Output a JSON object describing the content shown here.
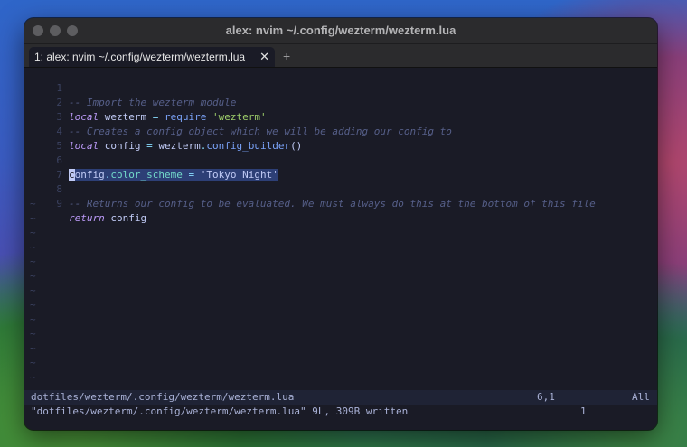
{
  "window": {
    "title": "alex: nvim ~/.config/wezterm/wezterm.lua"
  },
  "tabs": [
    {
      "label": "1: alex: nvim ~/.config/wezterm/wezterm.lua",
      "close_glyph": "✕"
    }
  ],
  "new_tab_glyph": "+",
  "editor": {
    "lines": [
      {
        "number": "1",
        "comment": "-- Import the wezterm module"
      },
      {
        "number": "2",
        "keyword": "local",
        "var": " wezterm ",
        "eq": "=",
        "fn": " require ",
        "str": "'wezterm'"
      },
      {
        "number": "3",
        "comment": "-- Creates a config object which we will be adding our config to"
      },
      {
        "number": "4",
        "keyword": "local",
        "var": " config ",
        "eq": "=",
        "obj": " wezterm",
        "dot": ".",
        "fn": "config_builder",
        "parens": "()"
      },
      {
        "number": "5"
      },
      {
        "number": "6",
        "cursor_char": "c",
        "obj": "onfig",
        "dot": ".",
        "prop": "color_scheme",
        "eq": " = ",
        "str": "'Tokyo Night'"
      },
      {
        "number": "7"
      },
      {
        "number": "8",
        "comment": "-- Returns our config to be evaluated. We must always do this at the bottom of this file"
      },
      {
        "number": "9",
        "keyword": "return",
        "var": " config"
      }
    ],
    "tilde": "~"
  },
  "statusline": {
    "file": "dotfiles/wezterm/.config/wezterm/wezterm.lua",
    "position": "6,1",
    "scroll": "All"
  },
  "cmdline": {
    "message": "\"dotfiles/wezterm/.config/wezterm/wezterm.lua\" 9L, 309B written",
    "count": "1"
  },
  "colors": {
    "background": "#1a1b26",
    "comment": "#565f89",
    "keyword": "#bb9af7",
    "function": "#7aa2f7",
    "string": "#9ece6a",
    "visual": "#2d3f76"
  }
}
